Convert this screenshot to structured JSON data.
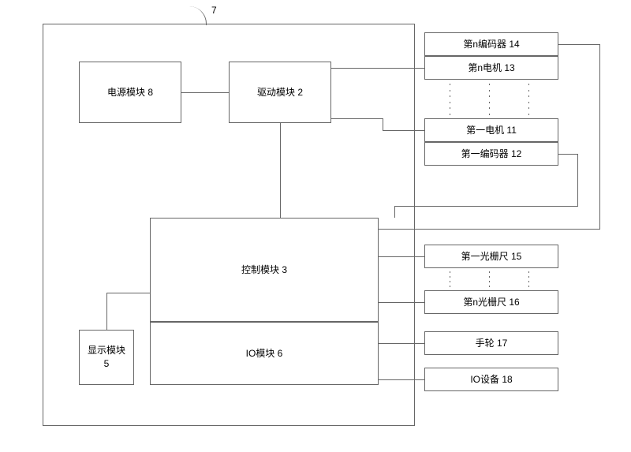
{
  "blocks": {
    "power": "电源模块 8",
    "drive": "驱动模块 2",
    "control": "控制模块 3",
    "io": "IO模块 6",
    "display": "显示模块\n5",
    "encoder_n": "第n编码器 14",
    "motor_n": "第n电机 13",
    "motor_1": "第一电机 11",
    "encoder_1": "第一编码器 12",
    "scale_1": "第一光栅尺 15",
    "scale_n": "第n光栅尺 16",
    "handwheel": "手轮 17",
    "io_device": "IO设备 18"
  },
  "lead": "7"
}
